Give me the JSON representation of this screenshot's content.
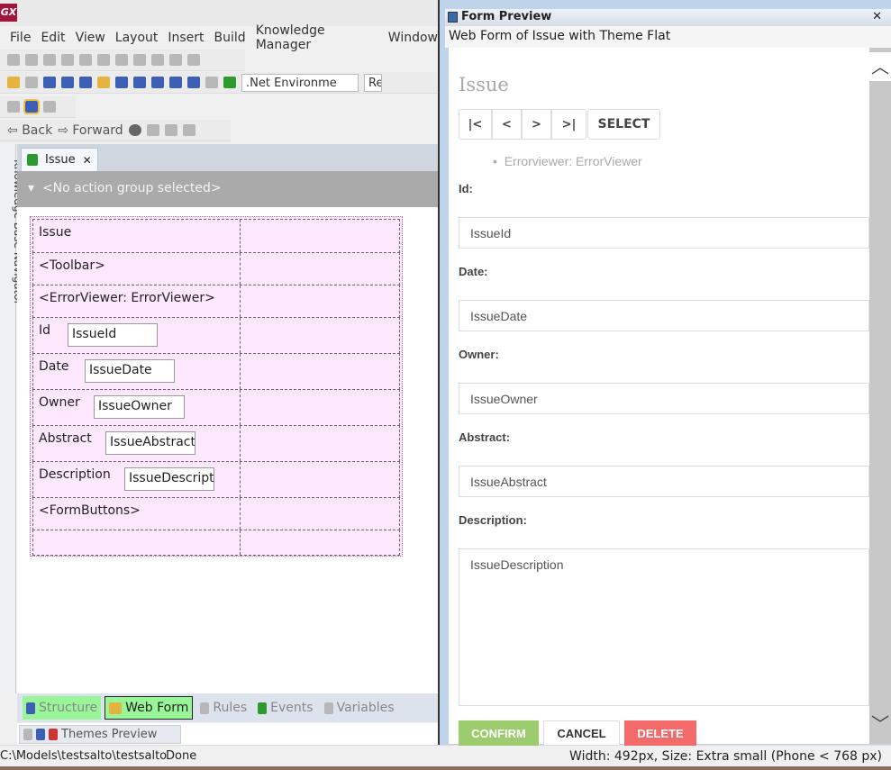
{
  "app": {
    "logo": "GX"
  },
  "menu": [
    "File",
    "Edit",
    "View",
    "Layout",
    "Insert",
    "Build",
    "Knowledge Manager",
    "Window"
  ],
  "toolbar": {
    "environment": ".Net Environme",
    "env_next": "Re",
    "back": "Back",
    "forward": "Forward"
  },
  "navigator": {
    "label": "Knowledge Base Navigator"
  },
  "document_tab": {
    "label": "Issue",
    "close": "✕"
  },
  "action_bar": {
    "text": "<No action group selected>"
  },
  "designer": {
    "rows": [
      {
        "label": "Issue"
      },
      {
        "label": "<Toolbar>"
      },
      {
        "label": "<ErrorViewer: ErrorViewer>"
      },
      {
        "label": "Id",
        "field": "IssueId"
      },
      {
        "label": "Date",
        "field": "IssueDate"
      },
      {
        "label": "Owner",
        "field": "IssueOwner"
      },
      {
        "label": "Abstract",
        "field": "IssueAbstract"
      },
      {
        "label": "Description",
        "field": "IssueDescription"
      },
      {
        "label": "<FormButtons>"
      },
      {
        "label": ""
      }
    ]
  },
  "bottom_tabs": [
    "Structure",
    "Web Form",
    "Rules",
    "Events",
    "Variables"
  ],
  "themes_tab": "Themes Preview",
  "status": {
    "path": "C:\\Models\\testsalto\\testsalto",
    "state": "Done",
    "preview_info": "Width: 492px, Size: Extra small (Phone < 768 px)"
  },
  "preview": {
    "title": "Form Preview",
    "close": "✕",
    "subtitle": "Web Form of Issue with Theme Flat",
    "form_title": "Issue",
    "nav_buttons": [
      "|<",
      "<",
      ">",
      ">|"
    ],
    "select": "SELECT",
    "error_viewer": "Errorviewer: ErrorViewer",
    "fields": [
      {
        "label": "Id:",
        "value": "IssueId"
      },
      {
        "label": "Date:",
        "value": "IssueDate"
      },
      {
        "label": "Owner:",
        "value": "IssueOwner"
      },
      {
        "label": "Abstract:",
        "value": "IssueAbstract"
      },
      {
        "label": "Description:",
        "value": "IssueDescription"
      }
    ],
    "confirm": "CONFIRM",
    "cancel": "CANCEL",
    "delete": "DELETE",
    "colors": {
      "confirm": "#9ccc6e",
      "delete": "#f26a6a",
      "active_tab": "#98f598"
    }
  }
}
